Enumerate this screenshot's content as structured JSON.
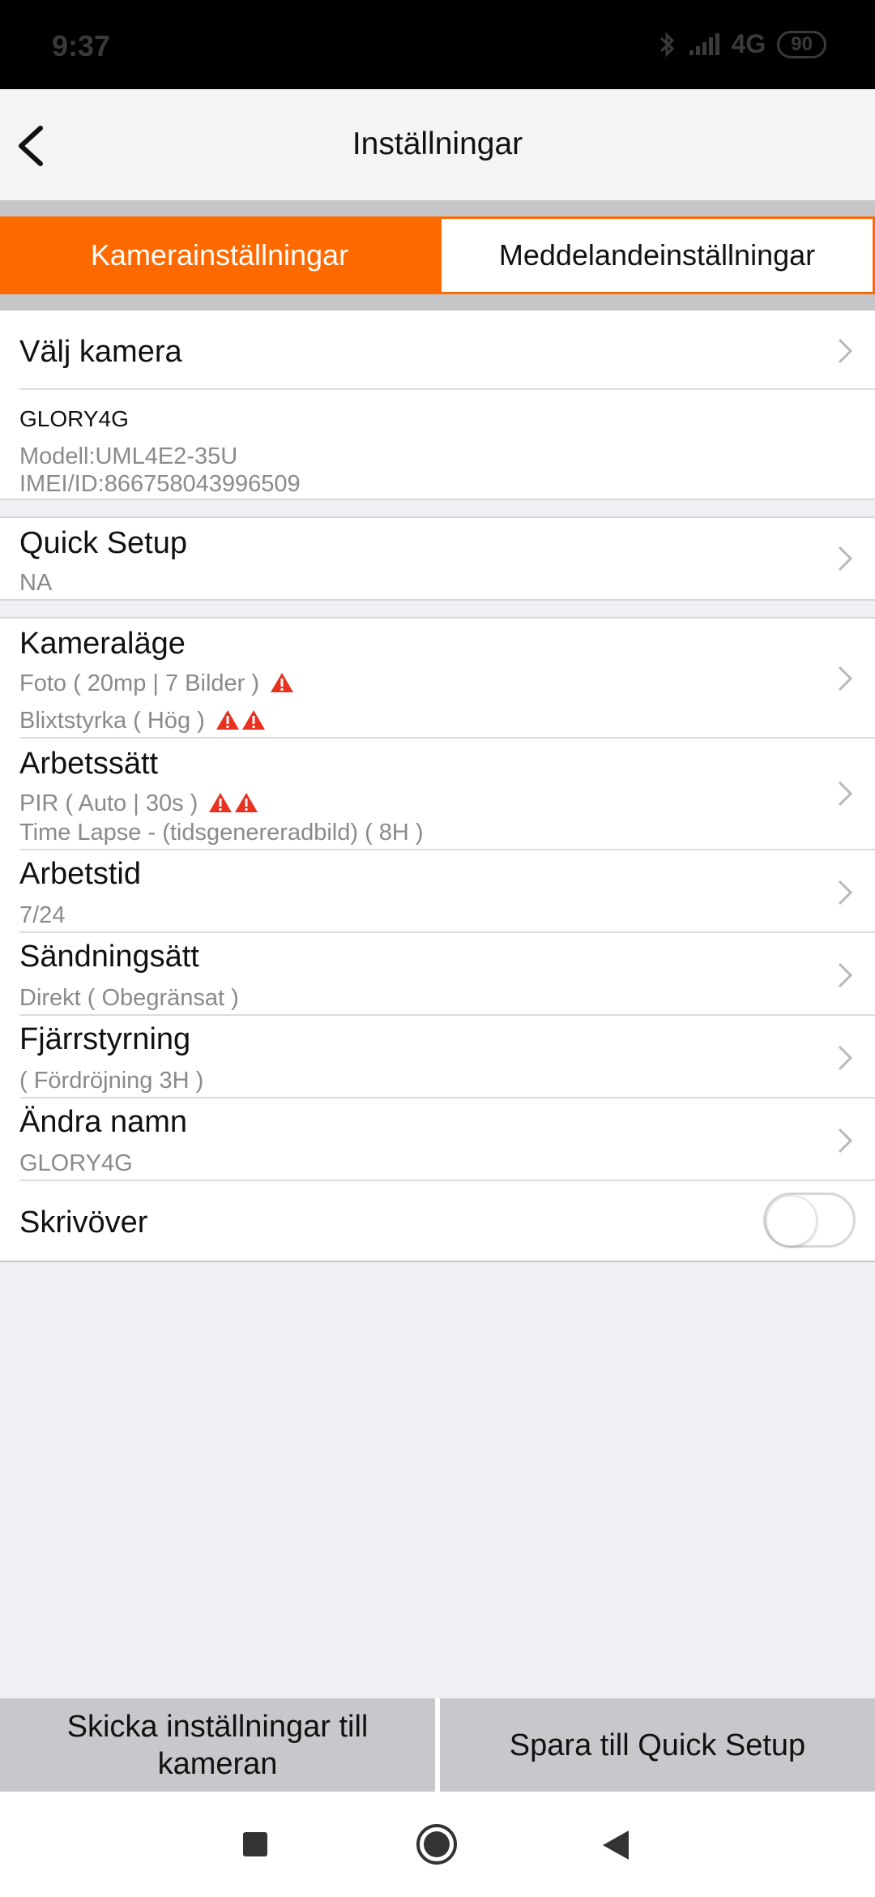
{
  "status_bar": {
    "time": "9:37",
    "network": "4G",
    "battery": "90"
  },
  "header": {
    "title": "Inställningar"
  },
  "tabs": [
    {
      "label": "Kamerainställningar",
      "active": true
    },
    {
      "label": "Meddelandeinställningar",
      "active": false
    }
  ],
  "camera": {
    "select_label": "Välj kamera",
    "name": "GLORY4G",
    "model": "Modell:UML4E2-35U",
    "imei": "IMEI/ID:866758043996509"
  },
  "quick_setup": {
    "title": "Quick Setup",
    "value": "NA"
  },
  "settings": {
    "camera_mode": {
      "title": "Kameraläge",
      "line1": "Foto  (  20mp  |  7 Bilder  )",
      "line2": "Blixtstyrka (  Hög  )"
    },
    "work_mode": {
      "title": "Arbetssätt",
      "line1": "PIR  (  Auto  |  30s  )",
      "line2": "Time Lapse - (tidsgenereradbild)   (  8H  )"
    },
    "work_time": {
      "title": "Arbetstid",
      "value": "7/24"
    },
    "send_mode": {
      "title": "Sändningsätt",
      "value": "Direkt  (  Obegränsat  )"
    },
    "remote": {
      "title": "Fjärrstyrning",
      "value": "(  Fördröjning 3H  )"
    },
    "rename": {
      "title": "Ändra namn",
      "value": "GLORY4G"
    },
    "overwrite": {
      "title": "Skrivöver",
      "enabled": false
    }
  },
  "bottom_actions": {
    "send_label": "Skicka inställningar till kameran",
    "save_label": "Spara till Quick Setup"
  },
  "colors": {
    "accent": "#ff6a00",
    "warning": "#e8311f"
  },
  "icons": {
    "back": "chevron-left-icon",
    "row": "chevron-right-icon",
    "warning": "warning-triangle-icon"
  }
}
